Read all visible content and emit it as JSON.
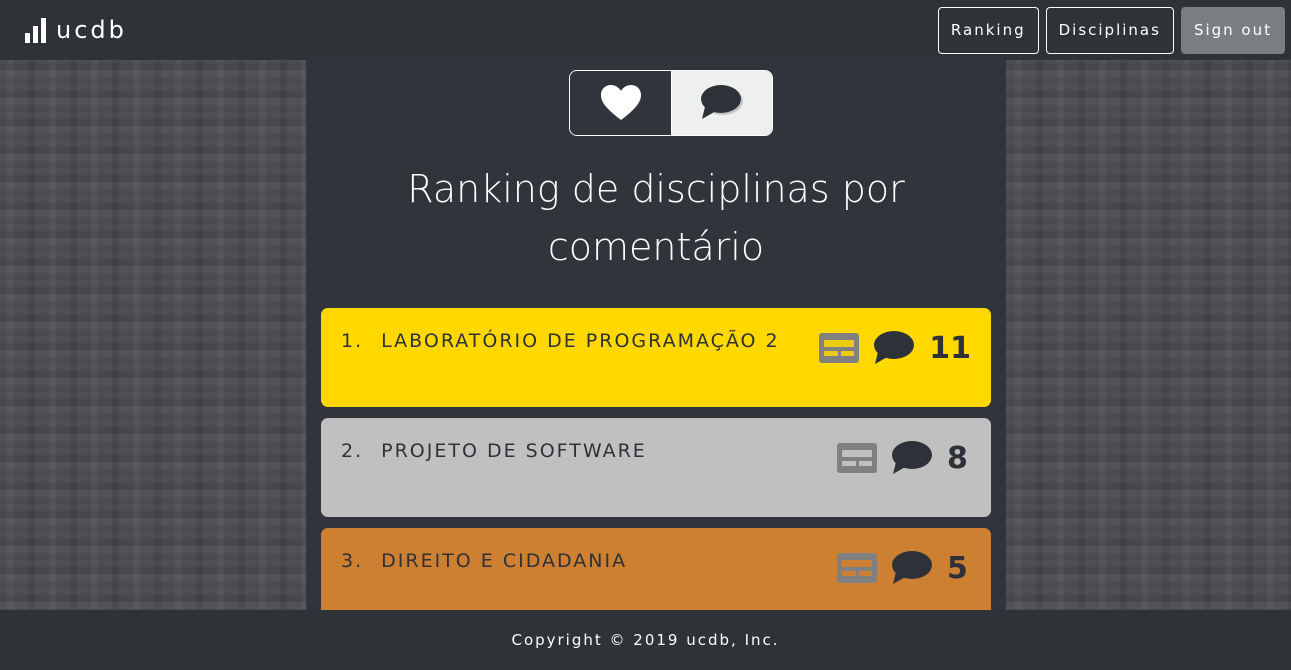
{
  "navbar": {
    "brand": "ucdb",
    "buttons": {
      "ranking": "Ranking",
      "disciplinas": "Disciplinas",
      "signout": "Sign out"
    }
  },
  "toggle": {
    "options": [
      {
        "icon": "heart-icon",
        "active": false
      },
      {
        "icon": "comment-icon",
        "active": true
      }
    ]
  },
  "page": {
    "title_line1": "Ranking de disciplinas por",
    "title_line2": "comentário"
  },
  "ranking": [
    {
      "position": "1.",
      "name": "LABORATÓRIO DE PROGRAMAÇÃO 2",
      "count": "11",
      "color": "#ffd800"
    },
    {
      "position": "2.",
      "name": "PROJETO DE SOFTWARE",
      "count": "8",
      "color": "#c0c0c0"
    },
    {
      "position": "3.",
      "name": "DIREITO E CIDADANIA",
      "count": "5",
      "color": "#cd7f32"
    }
  ],
  "footer": {
    "copyright": "Copyright © 2019 ucdb, Inc."
  }
}
